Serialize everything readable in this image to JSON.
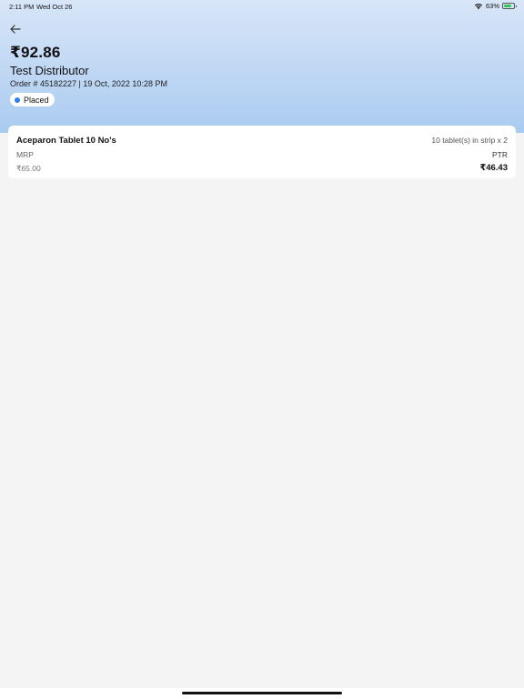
{
  "status_bar": {
    "time": "2:11 PM",
    "date": "Wed Oct 26",
    "battery": "63%",
    "battery_level": 0.63
  },
  "header": {
    "back_icon": "arrow-left-icon",
    "amount": "₹92.86",
    "distributor": "Test Distributor",
    "order_info": "Order # 45182227 | 19 Oct, 2022 10:28 PM",
    "status": {
      "label": "Placed",
      "color": "#2f80ed"
    }
  },
  "items": [
    {
      "name": "Aceparon Tablet 10 No's",
      "pack": "10 tablet(s) in strip x 2",
      "mrp_label": "MRP",
      "mrp_value": "₹65.00",
      "ptr_label": "PTR",
      "ptr_value": "₹46.43"
    }
  ]
}
